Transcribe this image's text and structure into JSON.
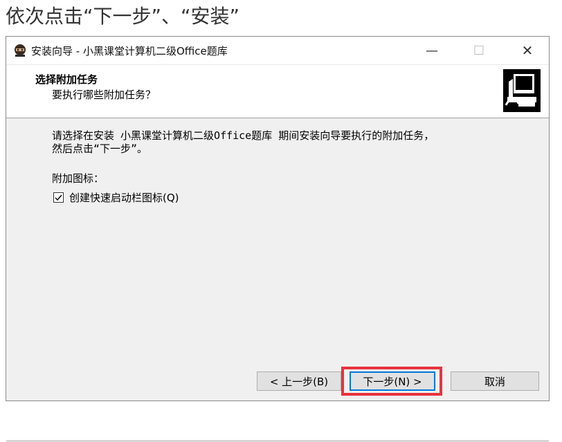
{
  "instruction": "依次点击“下一步”、“安装”",
  "window": {
    "title": "安装向导 - 小黑课堂计算机二级Office题库",
    "controls": {
      "minimize": "—",
      "maximize": "☐",
      "close": "✕"
    }
  },
  "header": {
    "title": "选择附加任务",
    "subtitle": "要执行哪些附加任务？"
  },
  "content": {
    "description_line1": "请选择在安装 小黑课堂计算机二级Office题库 期间安装向导要执行的附加任务，",
    "description_line2": "然后点击“下一步”。",
    "section_label": "附加图标：",
    "checkbox": {
      "label": "创建快速启动栏图标(Q)",
      "checked": true
    }
  },
  "buttons": {
    "back": "< 上一步(B)",
    "next": "下一步(N) >",
    "cancel": "取消"
  },
  "colors": {
    "highlight": "#e8323c",
    "focus": "#0078d7"
  }
}
